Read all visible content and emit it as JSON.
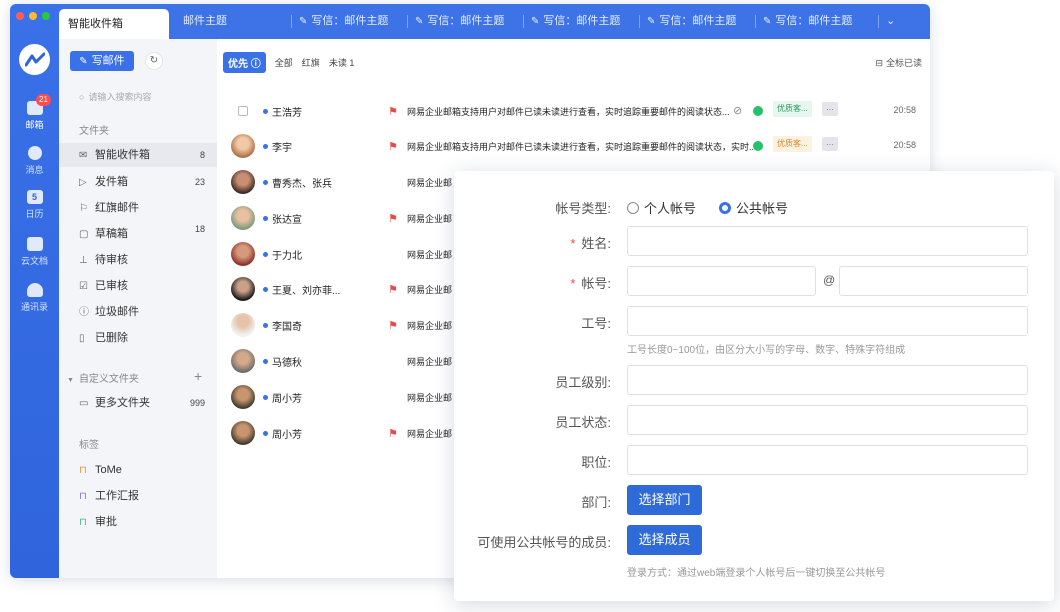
{
  "tabs": {
    "active": "智能收件箱",
    "items": [
      "邮件主题",
      "写信：邮件主题",
      "写信：邮件主题",
      "写信：邮件主题",
      "写信：邮件主题",
      "写信：邮件主题",
      "写信：邮件主题"
    ],
    "more": "⌄"
  },
  "rail": {
    "mail_label": "邮箱",
    "mail_badge": "21",
    "msg_label": "消息",
    "cal_label": "日历",
    "cal_day": "5",
    "docs_label": "云文档",
    "contacts_label": "通讯录"
  },
  "sidebar": {
    "compose_label": "写邮件",
    "search_placeholder": "请输入搜索内容",
    "folders_header": "文件夹",
    "folders": [
      {
        "label": "智能收件箱",
        "count": "8"
      },
      {
        "label": "发件箱",
        "count": "23"
      },
      {
        "label": "红旗邮件",
        "count": ""
      },
      {
        "label": "草稿箱",
        "count": "18"
      },
      {
        "label": "待审核",
        "count": ""
      },
      {
        "label": "已审核",
        "count": ""
      },
      {
        "label": "垃圾邮件",
        "count": ""
      },
      {
        "label": "已删除",
        "count": ""
      }
    ],
    "custom_header": "自定义文件夹",
    "custom_add": "+",
    "custom_folder": {
      "label": "更多文件夹",
      "count": "999"
    },
    "tags_header": "标签",
    "tags": [
      "ToMe",
      "工作汇报",
      "审批"
    ]
  },
  "list": {
    "priority_chip": "优先",
    "filters": [
      "全部",
      "红旗",
      "未读 1"
    ],
    "mark_all": "全标已读",
    "rows": [
      {
        "sender": "王浩芳",
        "subject": "网易企业邮箱支持用户对邮件已读未读进行查看，实时追踪重要邮件的阅读状态...",
        "tag": "优质客...",
        "time": "20:58"
      },
      {
        "sender": "李宇",
        "subject": "网易企业邮箱支持用户对邮件已读未读进行查看，实时追踪重要邮件的阅读状态，实时...",
        "tag": "优质客...",
        "time": "20:58"
      },
      {
        "sender": "曹秀杰、张兵",
        "subject": "网易企业邮"
      },
      {
        "sender": "张达宣",
        "subject": "网易企业邮"
      },
      {
        "sender": "于力北",
        "subject": "网易企业邮"
      },
      {
        "sender": "王夏、刘亦菲...",
        "subject": "网易企业邮"
      },
      {
        "sender": "李国奇",
        "subject": "网易企业邮"
      },
      {
        "sender": "马德秋",
        "subject": "网易企业邮"
      },
      {
        "sender": "周小芳",
        "subject": "网易企业邮"
      },
      {
        "sender": "周小芳",
        "subject": "网易企业邮"
      }
    ]
  },
  "form": {
    "account_type_label": "帐号类型:",
    "radio_personal": "个人帐号",
    "radio_public": "公共帐号",
    "name_label": "姓名:",
    "account_label": "帐号:",
    "at_sign": "@",
    "empno_label": "工号:",
    "empno_hint": "工号长度0~100位，由区分大小写的字母、数字、特殊字符组成",
    "level_label": "员工级别:",
    "status_label": "员工状态:",
    "position_label": "职位:",
    "dept_label": "部门:",
    "dept_button": "选择部门",
    "members_label": "可使用公共帐号的成员:",
    "members_button": "选择成员",
    "login_hint": "登录方式：通过web端登录个人帐号后一键切换至公共帐号"
  },
  "colors": {
    "accent": "#3a71e8",
    "flag": "#e84a4a",
    "tag_green": "#e7f6ee",
    "tag_orange": "#fdf1e2"
  }
}
